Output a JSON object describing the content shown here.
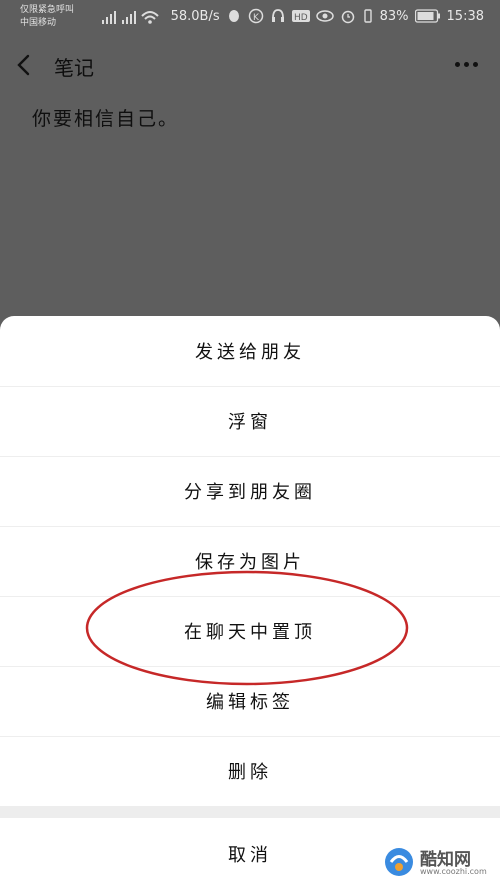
{
  "status_bar": {
    "carrier_line1": "仅限紧急呼叫",
    "carrier_line2": "中国移动",
    "net_speed": "58.0B/s",
    "battery": "83%",
    "time": "15:38"
  },
  "header": {
    "title": "笔记"
  },
  "note": {
    "content": "你要相信自己。"
  },
  "sheet": {
    "items": [
      "发送给朋友",
      "浮窗",
      "分享到朋友圈",
      "保存为图片",
      "在聊天中置顶",
      "编辑标签",
      "删除"
    ],
    "cancel": "取消"
  },
  "watermark": {
    "brand": "酷知网",
    "url": "www.coozhi.com"
  },
  "colors": {
    "overlay": "#5e5e5e",
    "highlight_ellipse": "#c62828"
  }
}
